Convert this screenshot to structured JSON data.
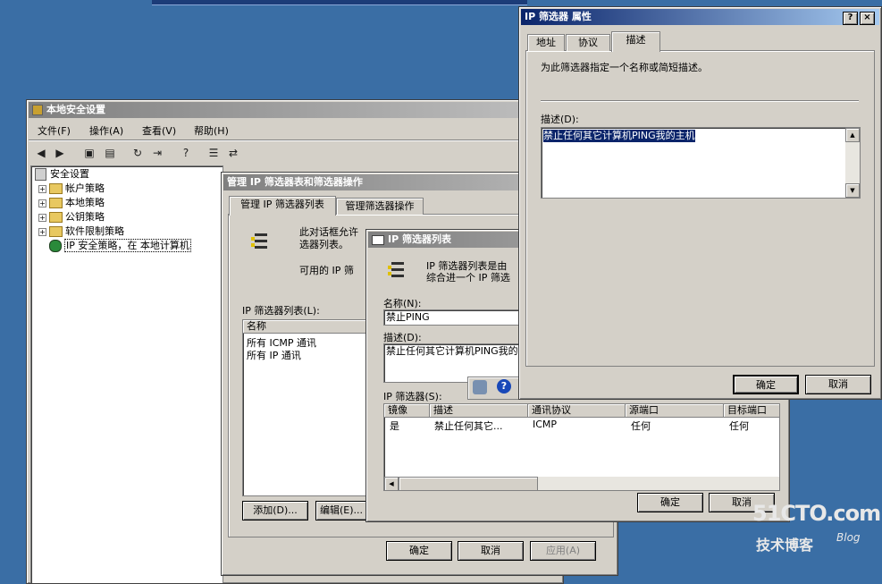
{
  "local_security": {
    "title": "本地安全设置",
    "menu": [
      "文件(F)",
      "操作(A)",
      "查看(V)",
      "帮助(H)"
    ],
    "tree": [
      {
        "label": "安全设置",
        "icon": "security-settings-icon"
      },
      {
        "label": "帐户策略",
        "icon": "folder-icon"
      },
      {
        "label": "本地策略",
        "icon": "folder-icon"
      },
      {
        "label": "公钥策略",
        "icon": "folder-icon"
      },
      {
        "label": "软件限制策略",
        "icon": "folder-icon"
      },
      {
        "label": "IP 安全策略，在 本地计算机",
        "icon": "ip-security-icon"
      }
    ]
  },
  "manage_filters": {
    "title": "管理 IP 筛选器表和筛选器操作",
    "tabs": [
      "管理 IP 筛选器列表",
      "管理筛选器操作"
    ],
    "intro": [
      "此对话框允许",
      "选器列表。"
    ],
    "available": "可用的 IP 筛",
    "list_label": "IP 筛选器列表(L):",
    "col_name": "名称",
    "rows": [
      "所有 ICMP 通讯",
      "所有 IP 通讯"
    ],
    "add": "添加(D)...",
    "edit": "编辑(E)...",
    "ok": "确定",
    "cancel": "取消",
    "apply": "应用(A)"
  },
  "filter_list": {
    "title": "IP 筛选器列表",
    "intro": [
      "IP 筛选器列表是由",
      "综合进一个 IP 筛选"
    ],
    "name_label": "名称(N):",
    "name_value": "禁止PING",
    "desc_label": "描述(D):",
    "desc_value": "禁止任何其它计算机PING我的",
    "filters_label": "IP 筛选器(S):",
    "columns": [
      "镜像",
      "描述",
      "通讯协议",
      "源端口",
      "目标端口"
    ],
    "rows": [
      [
        "是",
        "禁止任何其它...",
        "ICMP",
        "任何",
        "任何"
      ]
    ],
    "ok": "确定",
    "cancel": "取消"
  },
  "props": {
    "title": "IP 筛选器 属性",
    "tabs": [
      "地址",
      "协议",
      "描述"
    ],
    "instruction": "为此筛选器指定一个名称或简短描述。",
    "desc_label": "描述(D):",
    "desc_value": "禁止任何其它计算机PING我的主机",
    "ok": "确定",
    "cancel": "取消",
    "help_glyph": "?",
    "close_glyph": "×"
  },
  "watermark": {
    "brand": "51CTO.com",
    "sub": "技术博客",
    "blog": "Blog"
  }
}
